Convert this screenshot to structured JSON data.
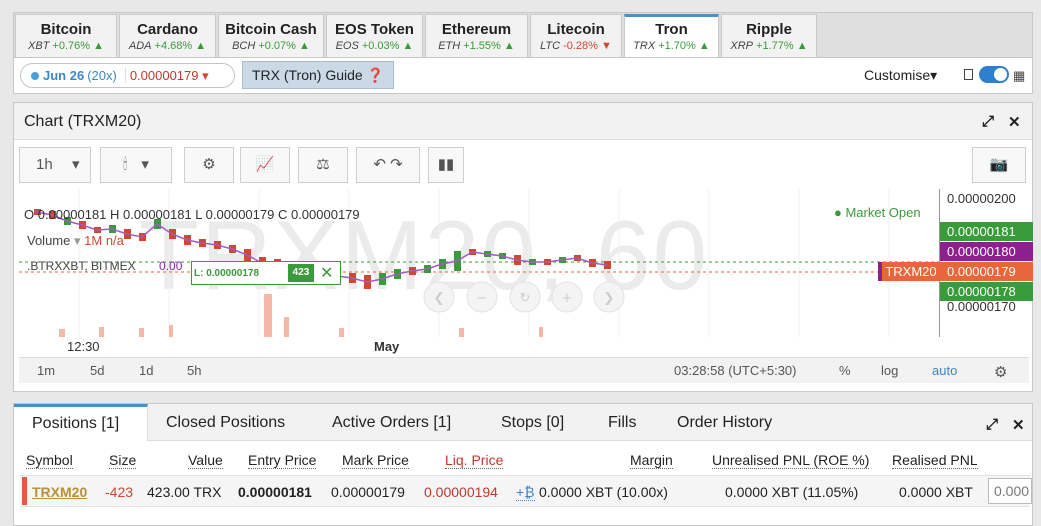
{
  "tabs": [
    {
      "name": "Bitcoin",
      "sym": "XBT",
      "chg": "+0.76%",
      "dir": "up"
    },
    {
      "name": "Cardano",
      "sym": "ADA",
      "chg": "+4.68%",
      "dir": "up"
    },
    {
      "name": "Bitcoin Cash",
      "sym": "BCH",
      "chg": "+0.07%",
      "dir": "up"
    },
    {
      "name": "EOS Token",
      "sym": "EOS",
      "chg": "+0.03%",
      "dir": "up"
    },
    {
      "name": "Ethereum",
      "sym": "ETH",
      "chg": "+1.55%",
      "dir": "up"
    },
    {
      "name": "Litecoin",
      "sym": "LTC",
      "chg": "-0.28%",
      "dir": "down"
    },
    {
      "name": "Tron",
      "sym": "TRX",
      "chg": "+1.70%",
      "dir": "up",
      "active": true
    },
    {
      "name": "Ripple",
      "sym": "XRP",
      "chg": "+1.77%",
      "dir": "up"
    }
  ],
  "subbar": {
    "date": "Jun 26",
    "leverage": "(20x)",
    "price": "0.00000179",
    "guide": "TRX (Tron) Guide",
    "customise": "Customise"
  },
  "chart": {
    "title": "Chart (TRXM20)",
    "watermark": "TRXM20, 60",
    "interval": "1h",
    "ohlc": "O 0.00000181  H 0.00000181  L 0.00000179  C 0.00000179",
    "market_status": "Market Open",
    "volume_label": "Volume",
    "volume_value": "1M  n/a",
    "compare_label": ".BTRXXBT, BITMEX",
    "compare_value": "0.00",
    "position_price": "L: 0.00000178",
    "position_qty": "423",
    "axis_labels": [
      {
        "text": "0.00000200",
        "style": "plain"
      },
      {
        "text": "0.00000181",
        "style": "green"
      },
      {
        "text": "0.00000180",
        "style": "purple"
      },
      {
        "text": "0.00000179",
        "style": "orange"
      },
      {
        "text": "0.00000178",
        "style": "green"
      },
      {
        "text": "0.00000170",
        "style": "plain"
      }
    ],
    "symbol_tag": "TRXM20",
    "x_labels": [
      "12:30",
      "May"
    ],
    "ranges": [
      "1m",
      "5d",
      "1d",
      "5h"
    ],
    "clock": "03:28:58 (UTC+5:30)",
    "scale_opts": [
      "%",
      "log",
      "auto"
    ]
  },
  "positions": {
    "tabs": [
      "Positions [1]",
      "Closed Positions",
      "Active Orders [1]",
      "Stops [0]",
      "Fills",
      "Order History"
    ],
    "headers": [
      "Symbol",
      "Size",
      "Value",
      "Entry Price",
      "Mark Price",
      "Liq. Price",
      "Margin",
      "Unrealised PNL (ROE %)",
      "Realised PNL"
    ],
    "row": {
      "symbol": "TRXM20",
      "size": "-423",
      "value": "423.00 TRX",
      "entry": "0.00000181",
      "mark": "0.00000179",
      "liq": "0.00000194",
      "margin_add": "+",
      "margin": "0.0000 XBT (10.00x)",
      "unrealised": "0.0000 XBT (11.05%)",
      "realised": "0.0000 XBT",
      "close_input": "0.000"
    }
  },
  "colors": {
    "up": "#3a9b3a",
    "down": "#d2472f",
    "accent": "#4a90c9"
  }
}
